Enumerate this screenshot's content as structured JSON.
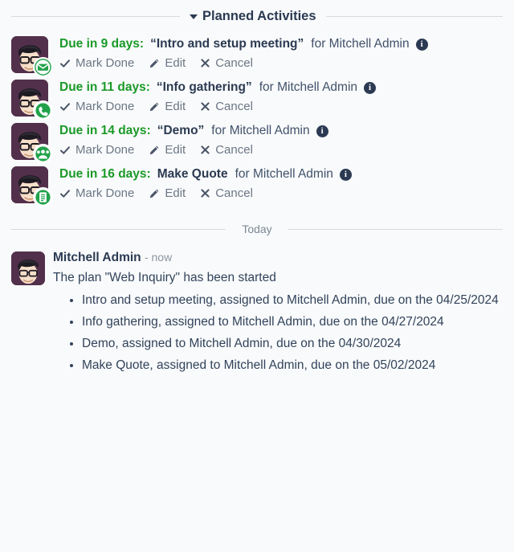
{
  "colors": {
    "background": "#f9fafb",
    "text": "#31435b",
    "heading": "#2b3a52",
    "due_green": "#1a9a28",
    "muted": "#7b8794",
    "divider": "#d8dadd",
    "badge_green": "#21a24a",
    "avatar_bg": "#52304b"
  },
  "header": {
    "title": "Planned Activities",
    "caret_icon": "chevron-down-icon"
  },
  "activities": [
    {
      "due": "Due in 9 days:",
      "name": "“Intro and setup meeting”",
      "assignee": "for Mitchell Admin",
      "info_icon": "info-icon",
      "badge_icon": "email-icon",
      "actions": [
        {
          "label": "Mark Done",
          "icon": "check-icon"
        },
        {
          "label": "Edit",
          "icon": "pencil-icon"
        },
        {
          "label": "Cancel",
          "icon": "close-icon"
        }
      ]
    },
    {
      "due": "Due in 11 days:",
      "name": "“Info gathering”",
      "assignee": "for Mitchell Admin",
      "info_icon": "info-icon",
      "badge_icon": "phone-icon",
      "actions": [
        {
          "label": "Mark Done",
          "icon": "check-icon"
        },
        {
          "label": "Edit",
          "icon": "pencil-icon"
        },
        {
          "label": "Cancel",
          "icon": "close-icon"
        }
      ]
    },
    {
      "due": "Due in 14 days:",
      "name": "“Demo”",
      "assignee": "for Mitchell Admin",
      "info_icon": "info-icon",
      "badge_icon": "users-meeting-icon",
      "actions": [
        {
          "label": "Mark Done",
          "icon": "check-icon"
        },
        {
          "label": "Edit",
          "icon": "pencil-icon"
        },
        {
          "label": "Cancel",
          "icon": "close-icon"
        }
      ]
    },
    {
      "due": "Due in 16 days:",
      "name": "Make Quote",
      "assignee": "for Mitchell Admin",
      "info_icon": "info-icon",
      "badge_icon": "document-icon",
      "actions": [
        {
          "label": "Mark Done",
          "icon": "check-icon"
        },
        {
          "label": "Edit",
          "icon": "pencil-icon"
        },
        {
          "label": "Cancel",
          "icon": "close-icon"
        }
      ]
    }
  ],
  "today_divider": {
    "label": "Today"
  },
  "message": {
    "author": "Mitchell Admin",
    "timestamp": "- now",
    "body": "The plan \"Web Inquiry\" has been started",
    "bullets": [
      "Intro and setup meeting, assigned to Mitchell Admin, due on the 04/25/2024",
      "Info gathering, assigned to Mitchell Admin, due on the 04/27/2024",
      "Demo, assigned to Mitchell Admin, due on the 04/30/2024",
      "Make Quote, assigned to Mitchell Admin, due on the 05/02/2024"
    ]
  }
}
